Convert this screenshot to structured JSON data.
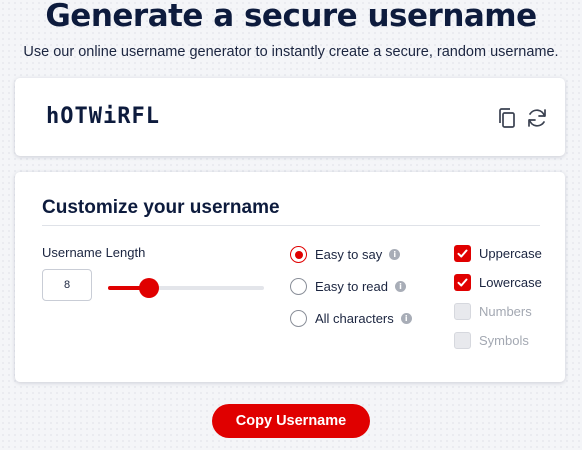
{
  "header": {
    "title": "Generate a secure username",
    "subtitle": "Use our online username generator to instantly create a secure, random username."
  },
  "generator": {
    "username": "hOTWiRFL",
    "copy_icon": "copy-icon",
    "refresh_icon": "refresh-icon"
  },
  "customize": {
    "title": "Customize your username",
    "length_label": "Username Length",
    "length_value": "8",
    "slider": {
      "min": 4,
      "max": 24,
      "value": 8
    },
    "radio_options": [
      {
        "label": "Easy to say",
        "checked": true
      },
      {
        "label": "Easy to read",
        "checked": false
      },
      {
        "label": "All characters",
        "checked": false
      }
    ],
    "checkbox_options": [
      {
        "label": "Uppercase",
        "checked": true,
        "disabled": false
      },
      {
        "label": "Lowercase",
        "checked": true,
        "disabled": false
      },
      {
        "label": "Numbers",
        "checked": false,
        "disabled": true
      },
      {
        "label": "Symbols",
        "checked": false,
        "disabled": true
      }
    ]
  },
  "actions": {
    "copy_button_label": "Copy Username"
  },
  "colors": {
    "accent": "#e00000",
    "heading": "#0d1b3d"
  }
}
